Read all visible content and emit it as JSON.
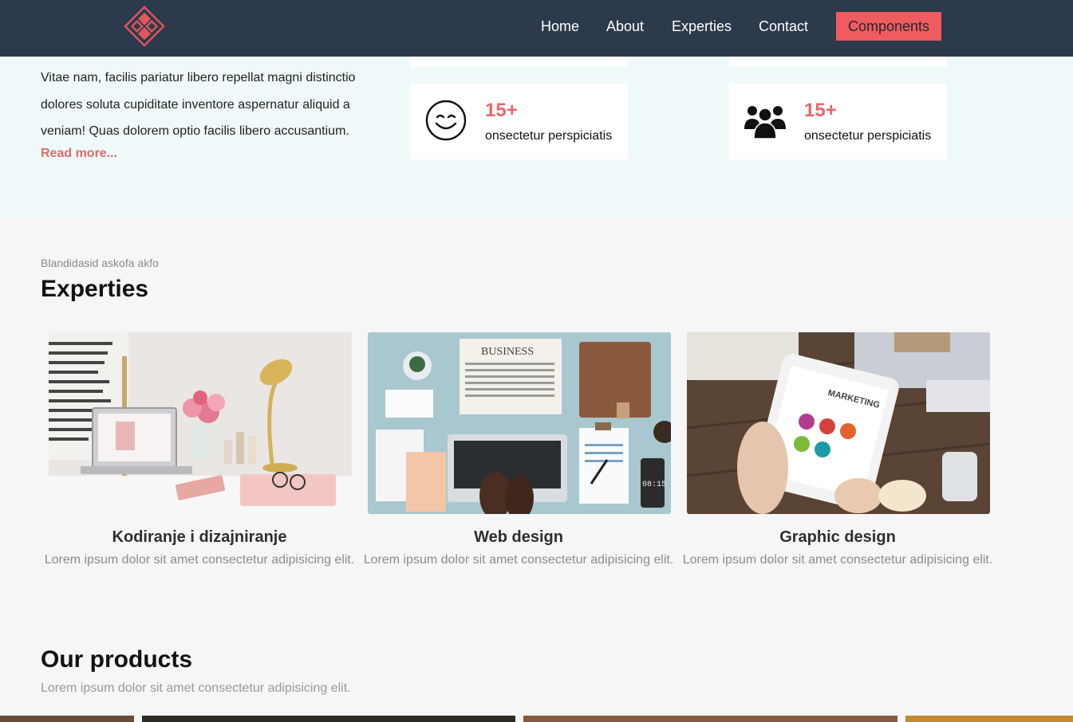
{
  "nav": {
    "logo_icon": "diamond-logo",
    "links": [
      "Home",
      "About",
      "Experties",
      "Contact"
    ],
    "cta": "Components",
    "colors": {
      "bar": "#2c3a4b",
      "cta": "#ef5b5f"
    }
  },
  "hero": {
    "paragraph": "Vitae nam, facilis pariatur libero repellat magni distinctio dolores soluta cupiditate inventore aspernatur aliquid a veniam! Quas dolorem optio facilis libero accusantium.",
    "read_more": "Read more...",
    "stats": [
      {
        "icon": "smiley-face-icon",
        "value": "15+",
        "label": "onsectetur perspiciatis"
      },
      {
        "icon": "users-group-icon",
        "value": "15+",
        "label": "onsectetur perspiciatis"
      }
    ]
  },
  "experties": {
    "eyebrow": "Blandidasid askofa akfo",
    "title": "Experties",
    "cards": [
      {
        "title": "Kodiranje i dizajniranje",
        "desc": "Lorem ipsum dolor sit amet consectetur adipisicing elit."
      },
      {
        "title": "Web design",
        "desc": "Lorem ipsum dolor sit amet consectetur adipisicing elit."
      },
      {
        "title": "Graphic design",
        "desc": "Lorem ipsum dolor sit amet consectetur adipisicing elit."
      }
    ]
  },
  "products": {
    "title": "Our products",
    "subtitle": "Lorem ipsum dolor sit amet consectetur adipisicing elit."
  },
  "accent_color": "#e8676b"
}
